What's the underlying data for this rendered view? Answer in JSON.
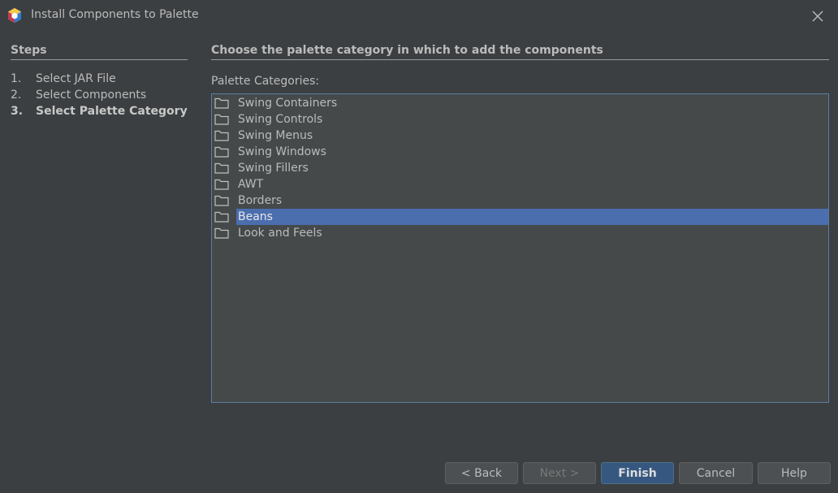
{
  "window": {
    "title": "Install Components to Palette",
    "icon": "netbeans-cube-icon"
  },
  "steps": {
    "heading": "Steps",
    "items": [
      {
        "num": "1.",
        "label": "Select JAR File",
        "current": false
      },
      {
        "num": "2.",
        "label": "Select Components",
        "current": false
      },
      {
        "num": "3.",
        "label": "Select Palette Category",
        "current": true
      }
    ]
  },
  "main": {
    "heading": "Choose the palette category in which to add the components",
    "list_label": "Palette Categories:",
    "categories": [
      {
        "label": "Swing Containers",
        "icon": "folder-icon",
        "selected": false
      },
      {
        "label": "Swing Controls",
        "icon": "folder-icon",
        "selected": false
      },
      {
        "label": "Swing Menus",
        "icon": "folder-icon",
        "selected": false
      },
      {
        "label": "Swing Windows",
        "icon": "folder-icon",
        "selected": false
      },
      {
        "label": "Swing Fillers",
        "icon": "folder-icon",
        "selected": false
      },
      {
        "label": "AWT",
        "icon": "folder-icon",
        "selected": false
      },
      {
        "label": "Borders",
        "icon": "folder-icon",
        "selected": false
      },
      {
        "label": "Beans",
        "icon": "folder-icon",
        "selected": true
      },
      {
        "label": "Look and Feels",
        "icon": "folder-icon",
        "selected": false
      }
    ]
  },
  "buttons": {
    "back": "< Back",
    "next": "Next >",
    "finish": "Finish",
    "cancel": "Cancel",
    "help": "Help"
  },
  "colors": {
    "background": "#3c3f41",
    "list_background": "#45494a",
    "selection": "#4b6eaf",
    "default_button": "#365880"
  }
}
